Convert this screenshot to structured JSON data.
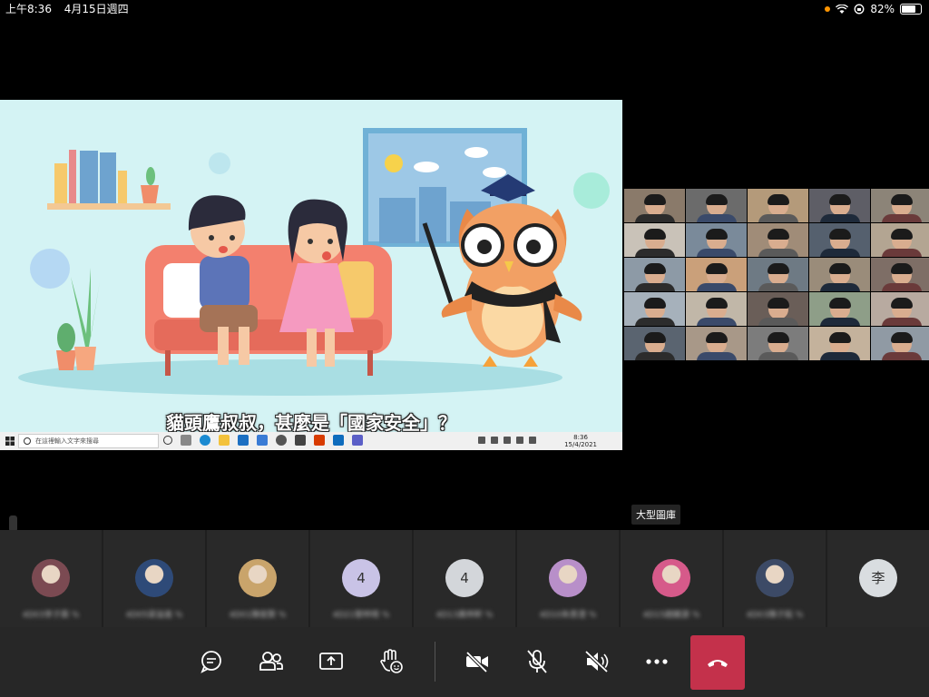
{
  "status_bar": {
    "time": "上午8:36",
    "date": "4月15日週四",
    "battery": "82%",
    "battery_level": 0.82
  },
  "shared_screen": {
    "caption": "貓頭鷹叔叔，甚麼是「國家安全」？",
    "taskbar": {
      "search_placeholder": "在這裡輸入文字來搜尋",
      "clock_time": "8:36",
      "clock_date": "15/4/2021"
    }
  },
  "gallery": {
    "label": "大型圖庫"
  },
  "participants": [
    {
      "avatar_type": "image",
      "avatar_color": "#7b4a52",
      "name": "4D03李子霖 %"
    },
    {
      "avatar_type": "image",
      "avatar_color": "#2e4a78",
      "name": "4D05梁溢進 %"
    },
    {
      "avatar_type": "image",
      "avatar_color": "#c9a46b",
      "name": "4D01陳俊賢 %"
    },
    {
      "avatar_type": "initial",
      "initial": "4",
      "avatar_color": "#c9c3e6",
      "name": "4D21黎梓晴 %"
    },
    {
      "avatar_type": "initial",
      "initial": "4",
      "avatar_color": "#d3d6da",
      "name": "4D13黃梓軒 %"
    },
    {
      "avatar_type": "image",
      "avatar_color": "#b88fc9",
      "name": "4D10朱恩澄 %"
    },
    {
      "avatar_type": "image",
      "avatar_color": "#d65a8a",
      "name": "4D15趙鍵源 %"
    },
    {
      "avatar_type": "image",
      "avatar_color": "#3c4a66",
      "name": "4D03陳子銘 %"
    },
    {
      "avatar_type": "initial",
      "initial": "李",
      "avatar_color": "#d9dde0",
      "name": ""
    }
  ],
  "controls": {
    "chat": "chat-icon",
    "participants": "people-icon",
    "share": "share-icon",
    "reactions": "raise-hand-icon",
    "camera": "camera-off-icon",
    "mic": "mic-off-icon",
    "speaker": "speaker-off-icon",
    "more": "more-icon",
    "hangup": "hang-up-icon",
    "hangup_color": "#c4314b"
  }
}
